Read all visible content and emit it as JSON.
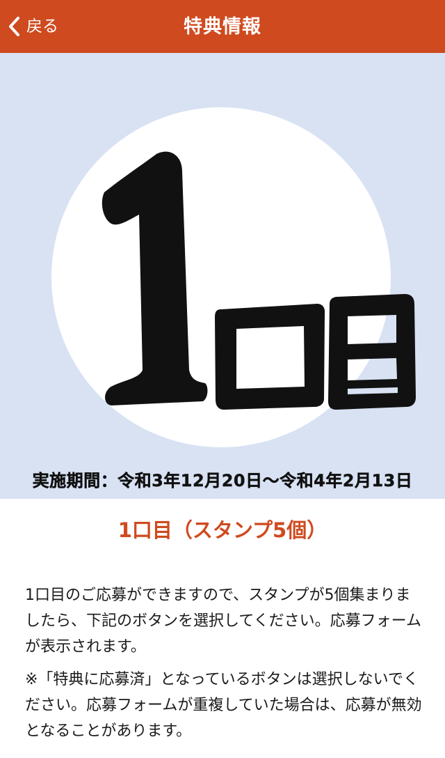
{
  "header": {
    "back_label": "戻る",
    "title": "特典情報"
  },
  "banner": {
    "big_number": "1",
    "big_suffix": "口目",
    "period": "実施期間：令和3年12月20日〜令和4年2月13日",
    "colors": {
      "background": "#d8e2f3",
      "circle": "#ffffff",
      "ink": "#111111"
    }
  },
  "section_title": "1口目（スタンプ5個）",
  "body": {
    "paragraph1": "1口目のご応募ができますので、スタンプが5個集まりましたら、下記のボタンを選択してください。応募フォームが表示されます。",
    "paragraph2": "※「特典に応募済」となっているボタンは選択しないでください。応募フォームが重複していた場合は、応募が無効となることがあります。"
  },
  "colors": {
    "accent": "#cf4a1f"
  }
}
